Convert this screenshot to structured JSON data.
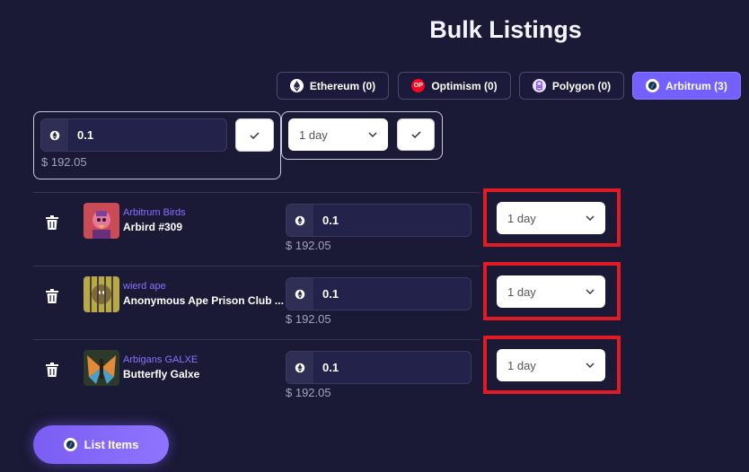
{
  "page": {
    "title": "Bulk Listings"
  },
  "chains": [
    {
      "label": "Ethereum (0)",
      "icon": "ethereum-icon",
      "color": "#2b2b4a"
    },
    {
      "label": "Optimism (0)",
      "icon": "optimism-icon",
      "color": "#ff0420",
      "glyph": "OP"
    },
    {
      "label": "Polygon (0)",
      "icon": "polygon-icon",
      "color": "#8247e5"
    },
    {
      "label": "Arbitrum (3)",
      "icon": "arbitrum-icon",
      "color": "#28a0f0",
      "active": true
    }
  ],
  "bulk": {
    "price": "0.1",
    "usd": "$ 192.05",
    "duration": "1 day"
  },
  "items": [
    {
      "collection": "Arbitrum Birds",
      "name": "Arbird #309",
      "price": "0.1",
      "usd": "$ 192.05",
      "duration": "1 day"
    },
    {
      "collection": "wierd ape",
      "name": "Anonymous Ape Prison Club ...",
      "price": "0.1",
      "usd": "$ 192.05",
      "duration": "1 day"
    },
    {
      "collection": "Arbigans GALXE",
      "name": "Butterfly Galxe",
      "price": "0.1",
      "usd": "$ 192.05",
      "duration": "1 day"
    }
  ],
  "list_button": {
    "label": "List Items"
  },
  "colors": {
    "accent": "#7360ff",
    "background": "#1a1936",
    "highlight": "#e01b24"
  }
}
